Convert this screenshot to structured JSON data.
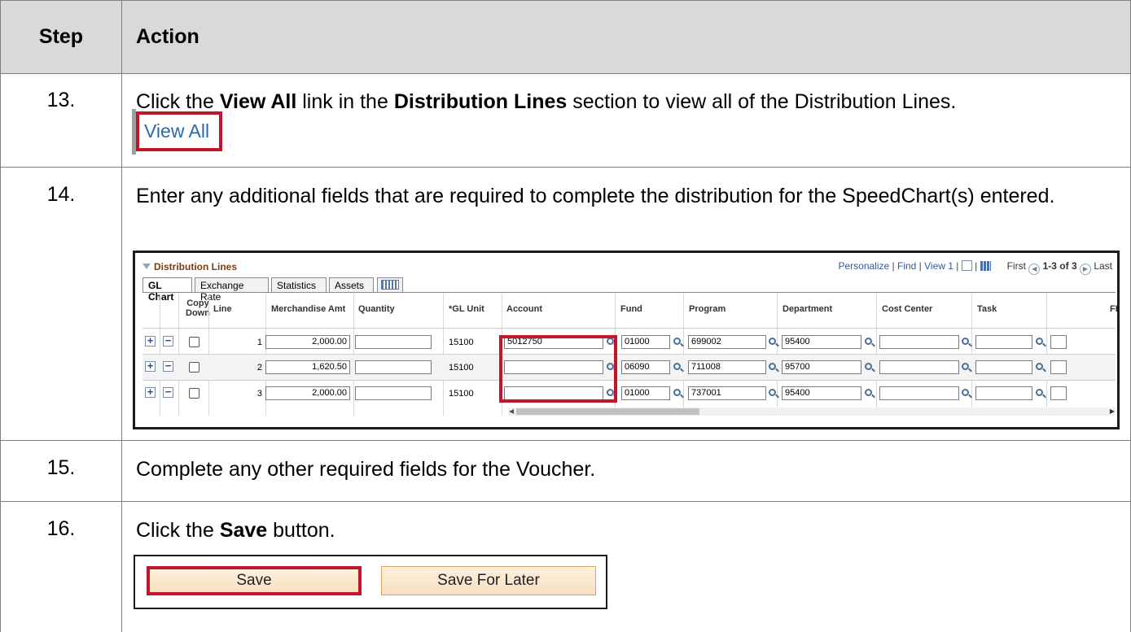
{
  "header": {
    "step": "Step",
    "action": "Action"
  },
  "steps": [
    {
      "num": "13.",
      "pre": "Click the ",
      "b1": "View All",
      "mid": " link in the ",
      "b2": "Distribution Lines",
      "post": " section to view all of the Distribution Lines."
    },
    {
      "num": "14.",
      "text": "Enter any additional fields that are required to complete the distribution for the SpeedChart(s) entered."
    },
    {
      "num": "15.",
      "text": "Complete any other required fields for the Voucher."
    },
    {
      "num": "16.",
      "pre": "Click the ",
      "b1": "Save",
      "post": " button."
    }
  ],
  "view_all": "View All",
  "distribution": {
    "title": "Distribution Lines",
    "nav": {
      "personalize": "Personalize",
      "find": "Find",
      "view1": "View 1",
      "first": "First",
      "range": "1-3 of 3",
      "last": "Last"
    },
    "tabs": [
      "GL Chart",
      "Exchange Rate",
      "Statistics",
      "Assets"
    ],
    "columns": {
      "copy": "Copy",
      "down": "Down",
      "line": "Line",
      "merch": "Merchandise Amt",
      "qty": "Quantity",
      "glunit": "*GL Unit",
      "account": "Account",
      "fund": "Fund",
      "program": "Program",
      "department": "Department",
      "cost_center": "Cost Center",
      "task": "Task",
      "fi": "FI"
    },
    "rows": [
      {
        "line": "1",
        "amount": "2,000.00",
        "qty": "",
        "glunit": "15100",
        "account": "5012750",
        "fund": "01000",
        "program": "699002",
        "department": "95400",
        "cost_center": "",
        "task": ""
      },
      {
        "line": "2",
        "amount": "1,620.50",
        "qty": "",
        "glunit": "15100",
        "account": "",
        "fund": "06090",
        "program": "711008",
        "department": "95700",
        "cost_center": "",
        "task": ""
      },
      {
        "line": "3",
        "amount": "2,000.00",
        "qty": "",
        "glunit": "15100",
        "account": "",
        "fund": "01000",
        "program": "737001",
        "department": "95400",
        "cost_center": "",
        "task": ""
      }
    ]
  },
  "buttons": {
    "save": "Save",
    "save_later": "Save For Later"
  }
}
